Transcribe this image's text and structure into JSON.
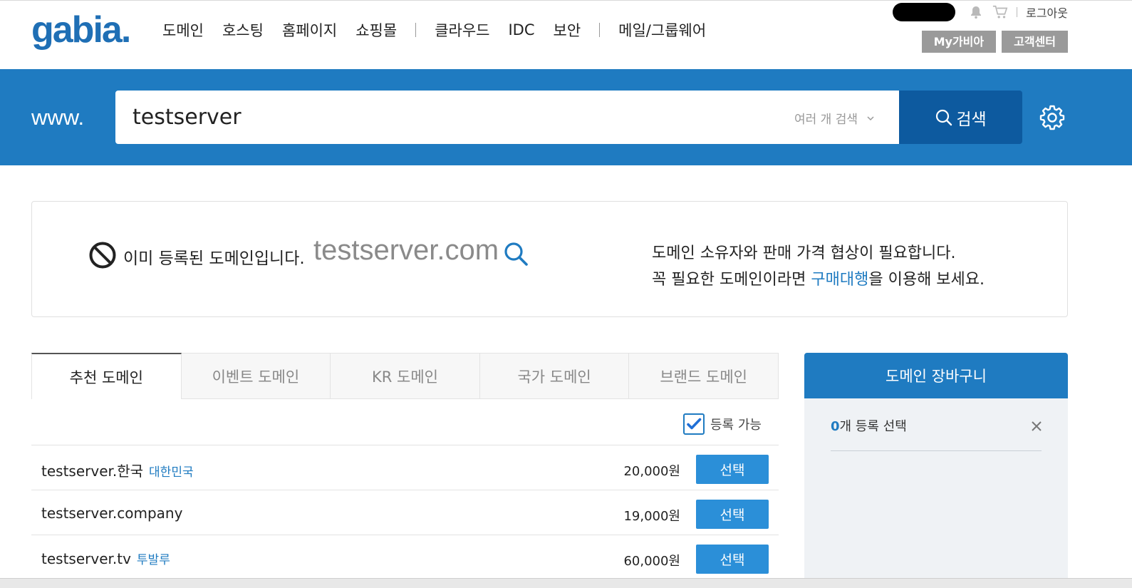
{
  "header": {
    "logo_text": "gabia",
    "logo_dot": ".",
    "nav": [
      "도메인",
      "호스팅",
      "홈페이지",
      "쇼핑몰",
      "클라우드",
      "IDC",
      "보안",
      "메일/그룹웨어"
    ],
    "logout": "로그아웃",
    "my_gabia": "My가비아",
    "customer_center": "고객센터"
  },
  "search": {
    "prefix": "www.",
    "value": "testserver",
    "multi_search": "여러 개 검색",
    "button": "검색"
  },
  "result": {
    "status": "이미 등록된 도메인입니다.",
    "domain": "testserver.com",
    "message_line1": "도메인 소유자와 판매 가격 협상이 필요합니다.",
    "message_line2_pre": "꼭 필요한 도메인이라면 ",
    "message_link": "구매대행",
    "message_line2_post": "을 이용해 보세요."
  },
  "tabs": [
    "추천 도메인",
    "이벤트 도메인",
    "KR 도메인",
    "국가 도메인",
    "브랜드 도메인"
  ],
  "filter": {
    "label": "등록 가능",
    "checked": true
  },
  "domains": [
    {
      "name": "testserver.한국",
      "country": "대한민국",
      "price": "20,000원",
      "button": "선택"
    },
    {
      "name": "testserver.company",
      "country": "",
      "price": "19,000원",
      "button": "선택"
    },
    {
      "name": "testserver.tv",
      "country": "투발루",
      "price": "60,000원",
      "button": "선택"
    }
  ],
  "cart": {
    "title": "도메인 장바구니",
    "count": "0",
    "count_suffix": "개 등록 선택"
  },
  "colors": {
    "brand": "#1f7bc1",
    "search_button": "#0d5a9f",
    "select_button": "#2b8fd8"
  }
}
